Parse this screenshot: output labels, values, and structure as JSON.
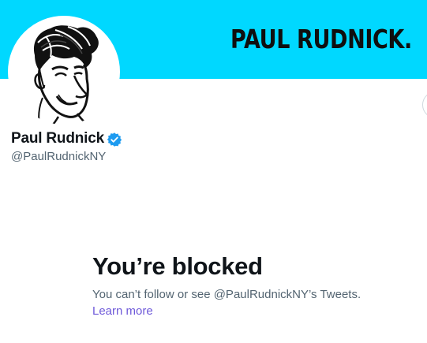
{
  "banner": {
    "text": "PAUL RUDNICK.",
    "background_color": "#00d8ff"
  },
  "avatar": {
    "icon": "caricature-avatar"
  },
  "profile": {
    "name": "Paul Rudnick",
    "verified_icon": "verified-badge-icon",
    "handle": "@PaulRudnickNY"
  },
  "blocked": {
    "title": "You’re blocked",
    "description": "You can’t follow or see @PaulRudnickNY’s Tweets.",
    "learn_more": "Learn more"
  },
  "colors": {
    "text_primary": "#0f1419",
    "text_secondary": "#536471",
    "link": "#6e59d9",
    "verified": "#1d9bf0"
  }
}
